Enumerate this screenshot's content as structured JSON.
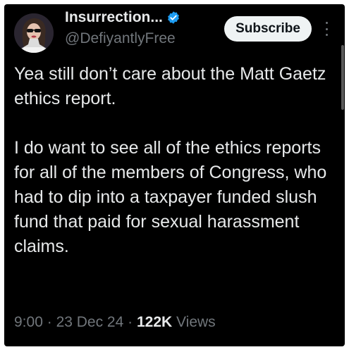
{
  "author": {
    "display_name": "Insurrection...",
    "handle": "@DefiyantlyFree",
    "verified": true,
    "verified_color": "#1d9bf0"
  },
  "header": {
    "subscribe_label": "Subscribe",
    "more_icon": "vertical-ellipsis-icon"
  },
  "tweet": {
    "paragraphs": [
      "Yea still don’t care about the Matt Gaetz ethics report.",
      "I do want to see all of the ethics reports for all of the members of Congress, who had to dip into a taxpayer funded slush fund that paid for sexual harassment claims."
    ]
  },
  "meta": {
    "time": "9:00",
    "separator": "·",
    "date": "23 Dec 24",
    "views_count": "122K",
    "views_label": "Views"
  },
  "colors": {
    "background": "#000000",
    "text": "#e7e9ea",
    "secondary_text": "#71767b",
    "button_bg": "#eff3f4"
  }
}
